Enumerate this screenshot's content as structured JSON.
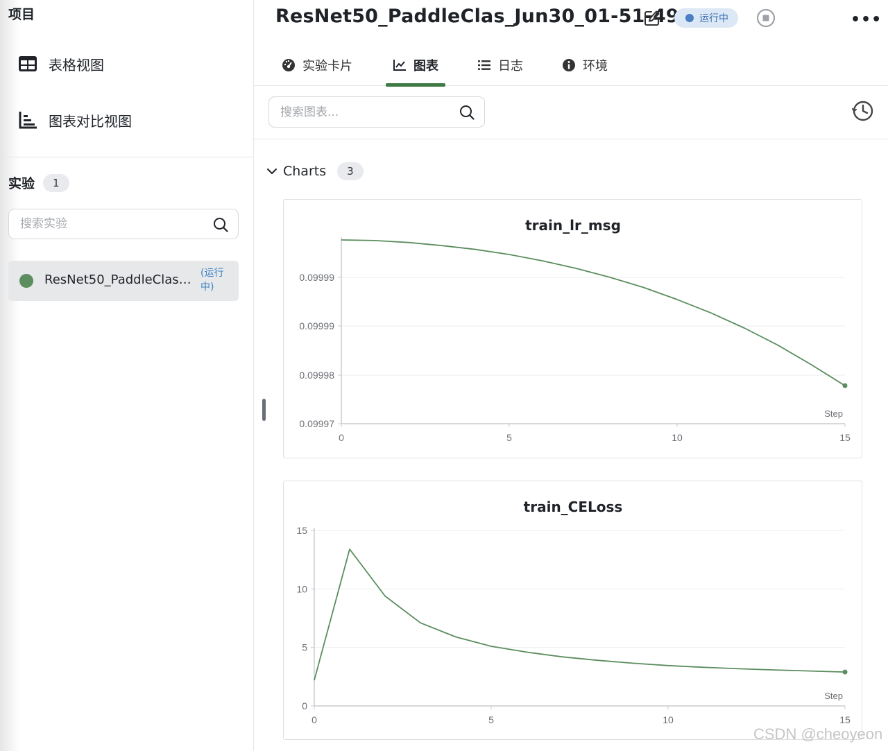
{
  "sidebar": {
    "project_title": "项目",
    "nav": {
      "table_view": "表格视图",
      "compare_view": "图表对比视图"
    },
    "experiments": {
      "label": "实验",
      "count": "1",
      "search_placeholder": "搜索实验",
      "items": [
        {
          "name": "ResNet50_PaddleClas…",
          "status": "(运行中)",
          "color": "#5b8d5e"
        }
      ]
    }
  },
  "header": {
    "run_title": "ResNet50_PaddleClas_Jun30_01-51-49",
    "status": "运行中",
    "more": "•••"
  },
  "tabs": [
    {
      "label": "实验卡片",
      "icon": "dashboard-icon"
    },
    {
      "label": "图表",
      "icon": "line-chart-icon",
      "active": true
    },
    {
      "label": "日志",
      "icon": "list-icon"
    },
    {
      "label": "环境",
      "icon": "info-icon"
    }
  ],
  "toolbar": {
    "search_placeholder": "搜索图表..."
  },
  "group": {
    "label": "Charts",
    "count": "3"
  },
  "colors": {
    "accent": "#3f7a45",
    "line": "#5b8d5e",
    "status_blue": "#4a7fc4"
  },
  "chart_data": [
    {
      "type": "line",
      "title": "train_lr_msg",
      "xlabel": "Step",
      "x": [
        0,
        1,
        2,
        3,
        4,
        5,
        6,
        7,
        8,
        9,
        10,
        11,
        12,
        13,
        14,
        15
      ],
      "series": [
        {
          "values": [
            0.099999,
            0.0999989,
            0.0999986,
            0.0999981,
            0.0999975,
            0.0999967,
            0.0999957,
            0.0999945,
            0.0999931,
            0.0999915,
            0.0999896,
            0.0999875,
            0.0999851,
            0.0999824,
            0.0999793,
            0.099976
          ]
        }
      ],
      "xlim": [
        0,
        15
      ],
      "ylim": [
        0.09997,
        0.099999
      ],
      "x_ticks": [
        "0",
        "5",
        "10",
        "15"
      ],
      "y_ticks": [
        "0.09997",
        "0.09998",
        "0.09999",
        "0.09999"
      ],
      "y_tick_values": [
        0.09997,
        0.09998,
        0.09999,
        0.09999
      ],
      "grid": true
    },
    {
      "type": "line",
      "title": "train_CELoss",
      "xlabel": "Step",
      "x": [
        0,
        1,
        2,
        3,
        4,
        5,
        6,
        7,
        8,
        9,
        10,
        11,
        12,
        13,
        14,
        15
      ],
      "series": [
        {
          "values": [
            2.2,
            13.4,
            9.4,
            7.1,
            5.9,
            5.1,
            4.6,
            4.2,
            3.9,
            3.65,
            3.45,
            3.3,
            3.18,
            3.08,
            2.99,
            2.9
          ]
        }
      ],
      "xlim": [
        0,
        15
      ],
      "ylim": [
        0,
        15
      ],
      "x_ticks": [
        "0",
        "5",
        "10",
        "15"
      ],
      "y_ticks": [
        "0",
        "5",
        "10",
        "15"
      ],
      "grid": true
    }
  ],
  "watermark": "CSDN @cheoyeon"
}
